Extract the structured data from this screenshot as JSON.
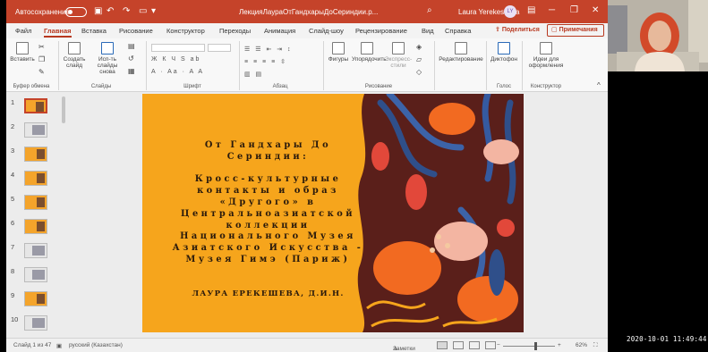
{
  "titlebar": {
    "autosave_label": "Автосохранение",
    "document_title": "ЛекцияЛаураОтГандхарыДоСериндии.p...",
    "search_icon": "search-icon",
    "user_name": "Laura Yerekesheva",
    "user_initials": "LY"
  },
  "tabs": [
    "Файл",
    "Главная",
    "Вставка",
    "Рисование",
    "Конструктор",
    "Переходы",
    "Анимация",
    "Слайд-шоу",
    "Рецензирование",
    "Вид",
    "Справка"
  ],
  "active_tab": "Главная",
  "share_label": "Поделиться",
  "comments_label": "Примечания",
  "ribbon": {
    "paste_label": "Вставить",
    "new_slide_label": "Создать слайд",
    "reuse_slides_label": "Исп-ть слайды снова",
    "shapes_label": "Фигуры",
    "arrange_label": "Упорядочить",
    "quick_styles_label": "Экспресс-стили",
    "editing_label": "Редактирование",
    "dictate_label": "Диктофон",
    "design_ideas_label": "Идеи для оформления",
    "groups": {
      "clipboard": "Буфер обмена",
      "slides": "Слайды",
      "font": "Шрифт",
      "paragraph": "Абзац",
      "drawing": "Рисование",
      "voice": "Голос",
      "designer": "Конструктор"
    }
  },
  "thumbnails": [
    "1",
    "2",
    "3",
    "4",
    "5",
    "6",
    "7",
    "8",
    "9",
    "10"
  ],
  "slide": {
    "title": "От Гандхары До\nСериндии:\n\nКросс-культурные\nконтакты и образ\n«Другого» в\nЦентральноазиатской\nколлекции\nНационального Музея\nАзиатского Искусства -\nМузея Гимэ (Париж)",
    "author": "ЛАУРА ЕРЕКЕШЕВА, Д.И.Н."
  },
  "statusbar": {
    "slide_counter": "Слайд 1 из 47",
    "language": "русский (Казахстан)",
    "notes_label": "Заметки",
    "zoom": "62%"
  },
  "zoom_slider_fraction": 0.62,
  "timestamp": "2020-10-01 11:49:44",
  "colors": {
    "accent": "#c5432a",
    "slide_background": "#f6a51c"
  }
}
